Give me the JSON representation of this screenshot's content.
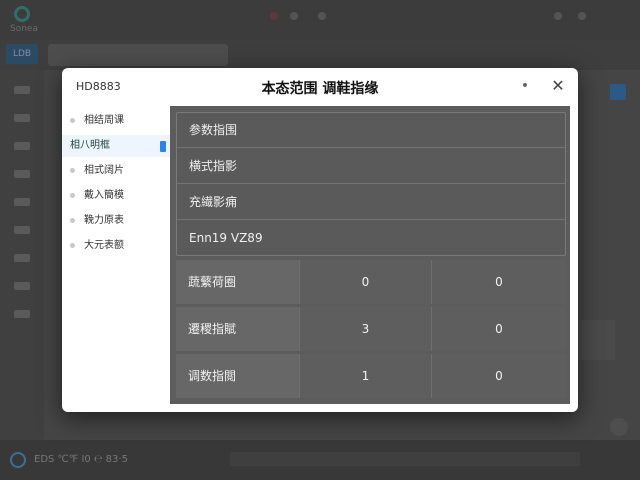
{
  "background": {
    "app_name": "Sonea",
    "tag": "LDB",
    "footer_text": "EDS ℃℉ I0 ℮ 83·5"
  },
  "modal": {
    "brand": "HD8883",
    "title": "本态范围 调鞋指缘",
    "more_label": "•",
    "close_label": "✕",
    "nav": [
      {
        "label": "相结周课",
        "active": false
      },
      {
        "label": "相八明框",
        "active": true
      },
      {
        "label": "相式阔片",
        "active": false
      },
      {
        "label": "戴入簡模",
        "active": false
      },
      {
        "label": "鞔力原表",
        "active": false
      },
      {
        "label": "大元表额",
        "active": false
      }
    ],
    "list": [
      "参数指围",
      "横式指影",
      "充繊影痈",
      "Enn19 VZ89"
    ],
    "grid": [
      {
        "label": "蔬蘩荷圈",
        "v1": "0",
        "v2": "0"
      },
      {
        "label": "遷稷指賦",
        "v1": "3",
        "v2": "0"
      },
      {
        "label": "调数指閲",
        "v1": "1",
        "v2": "0"
      }
    ]
  },
  "colors": {
    "accent": "#2a86e8",
    "overlay": "#454545",
    "panel": "#5c5c5c"
  }
}
